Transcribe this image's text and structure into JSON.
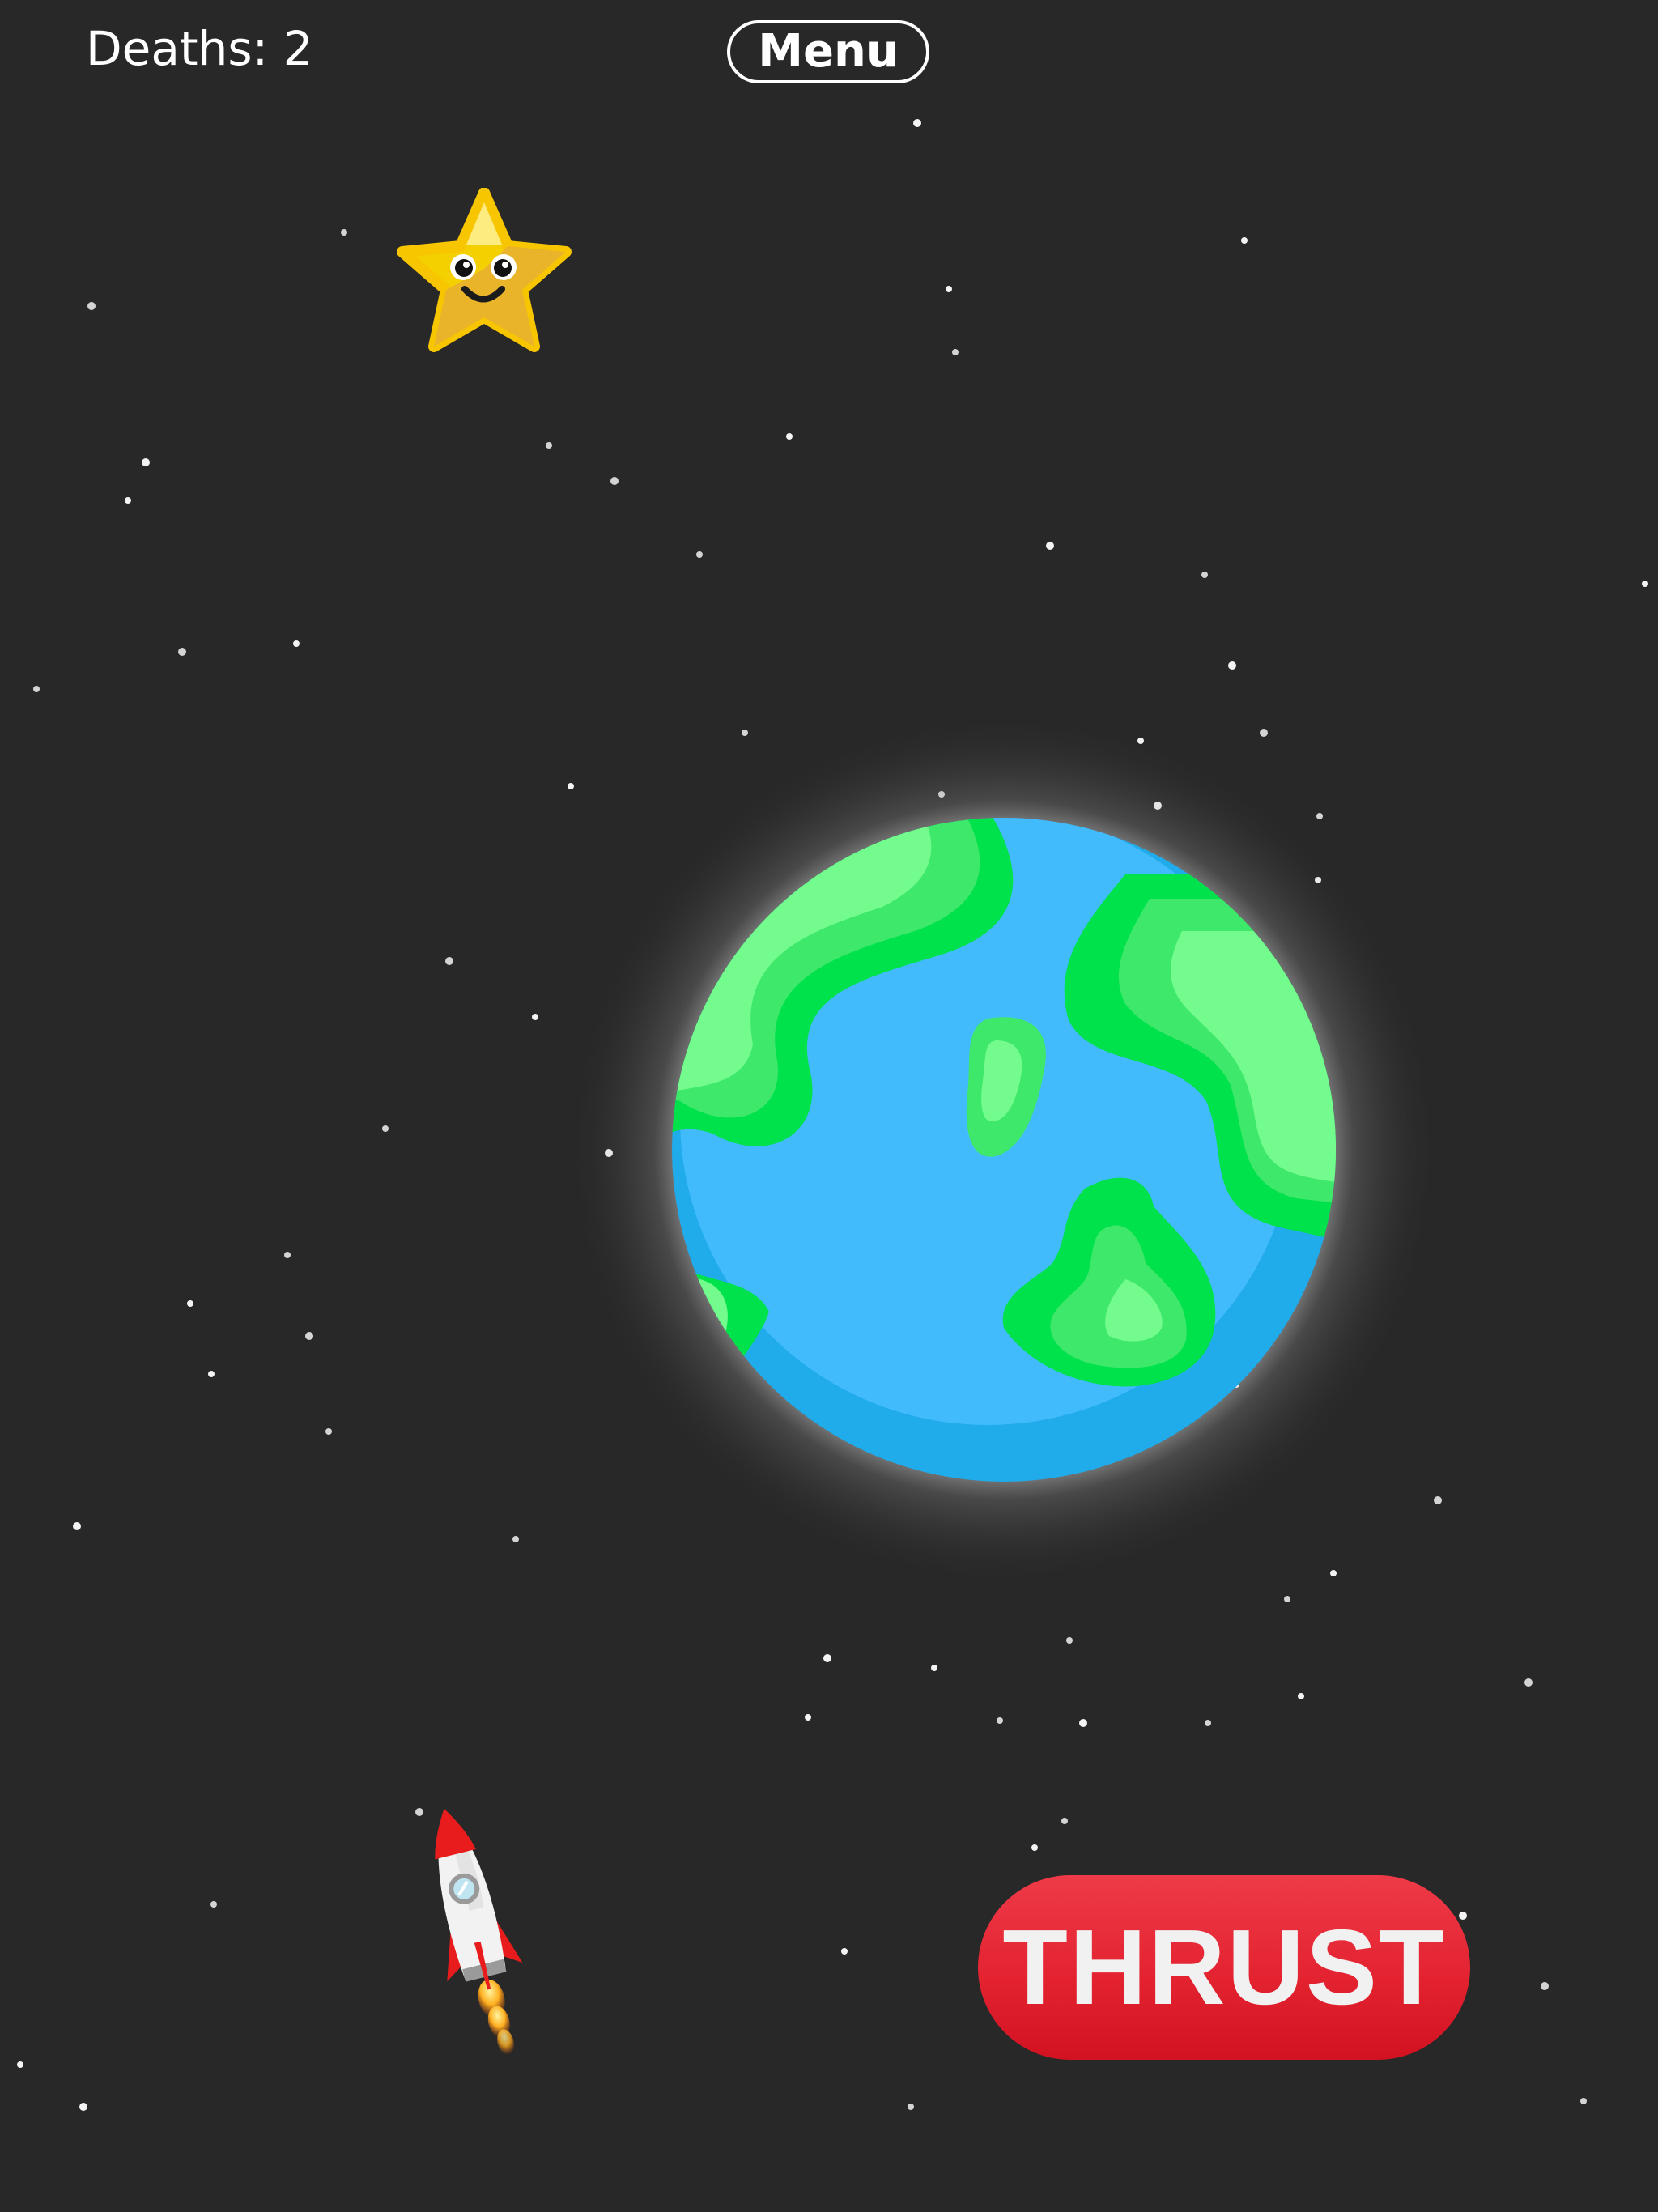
{
  "hud": {
    "deaths_text": "Deaths: 2",
    "menu_label": "Menu"
  },
  "controls": {
    "thrust_label": "THRUST"
  },
  "sprites": {
    "goal": "smiling-star-icon",
    "planet": "earth-planet-icon",
    "player": "rocket-ship-icon"
  },
  "colors": {
    "background": "#282828",
    "thrust_button": "#e42331",
    "ocean": "#42bbfd",
    "land": "#00e24b",
    "star_yellow": "#f5d000"
  }
}
